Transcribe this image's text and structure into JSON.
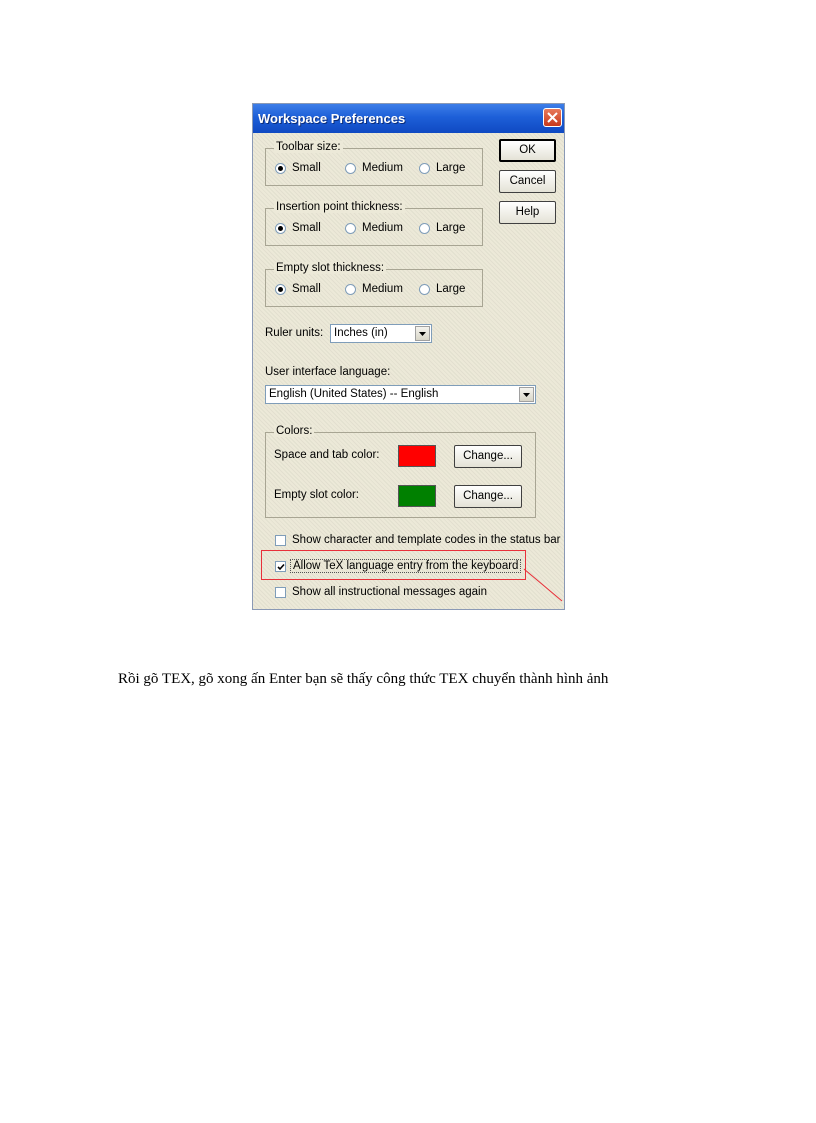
{
  "dialog": {
    "title": "Workspace Preferences",
    "buttons": {
      "ok": "OK",
      "cancel": "Cancel",
      "help": "Help"
    },
    "toolbar_size": {
      "label": "Toolbar size:",
      "options": [
        "Small",
        "Medium",
        "Large"
      ],
      "selected": "Small"
    },
    "insertion_point": {
      "label": "Insertion point thickness:",
      "options": [
        "Small",
        "Medium",
        "Large"
      ],
      "selected": "Small"
    },
    "empty_slot": {
      "label": "Empty slot thickness:",
      "options": [
        "Small",
        "Medium",
        "Large"
      ],
      "selected": "Small"
    },
    "ruler_units": {
      "label": "Ruler units:",
      "value": "Inches (in)"
    },
    "ui_language": {
      "label": "User interface language:",
      "value": "English (United States)  --  English"
    },
    "colors": {
      "label": "Colors:",
      "space_tab": {
        "label": "Space and tab color:",
        "color": "#ff0000",
        "button": "Change..."
      },
      "empty_slot": {
        "label": "Empty slot color:",
        "color": "#008000",
        "button": "Change..."
      }
    },
    "checkboxes": [
      {
        "label": "Show character and template codes in the status bar",
        "checked": false
      },
      {
        "label": "Allow TeX language entry from the keyboard",
        "checked": true
      },
      {
        "label": "Show all instructional messages again",
        "checked": false
      }
    ],
    "highlight_color": "#e8303a"
  },
  "caption": "Rồi gõ TEX, gõ xong ấn Enter bạn sẽ thấy công thức TEX chuyển thành hình ảnh"
}
